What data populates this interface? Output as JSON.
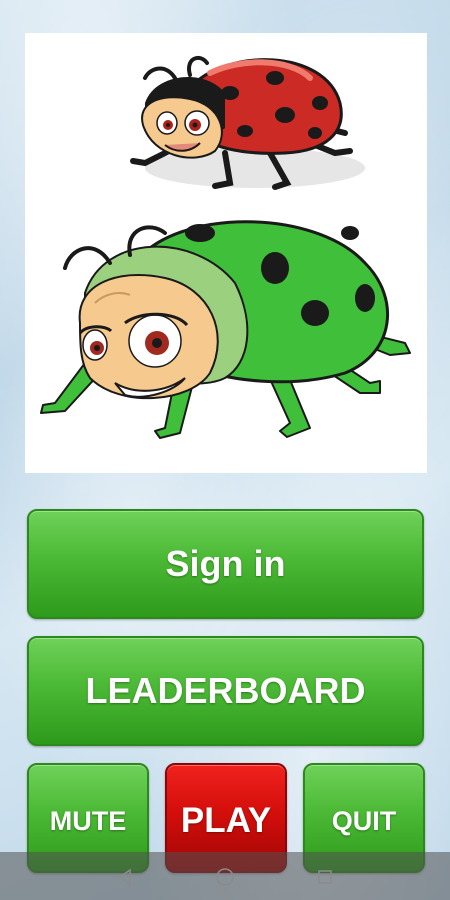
{
  "buttons": {
    "sign_in": "Sign in",
    "leaderboard": "LEADERBOARD",
    "mute": "MUTE",
    "play": "PLAY",
    "quit": "QUIT"
  },
  "colors": {
    "green_button": "#4bb935",
    "red_button": "#d40e0b",
    "background": "#c6dbea"
  },
  "icons": {
    "nav_back": "triangle-back-icon",
    "nav_home": "circle-home-icon",
    "nav_recents": "square-recents-icon"
  }
}
